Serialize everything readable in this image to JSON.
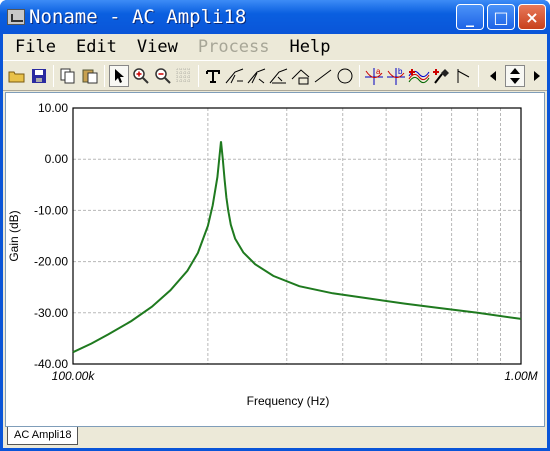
{
  "window": {
    "title": "Noname - AC Ampli18",
    "controls": [
      "_",
      "□",
      "×"
    ]
  },
  "menu": {
    "items": [
      {
        "label": "File",
        "enabled": true
      },
      {
        "label": "Edit",
        "enabled": true
      },
      {
        "label": "View",
        "enabled": true
      },
      {
        "label": "Process",
        "enabled": false
      },
      {
        "label": "Help",
        "enabled": true
      }
    ]
  },
  "toolbar": {
    "tools": [
      "open-icon",
      "save-icon",
      "copy-icon",
      "paste-icon",
      "pointer-icon",
      "zoom-in-icon",
      "zoom-out-icon",
      "grid-icon",
      "text-icon",
      "curve-tool-1-icon",
      "curve-tool-2-icon",
      "curve-tool-3-icon",
      "curve-tool-4-icon",
      "line-icon",
      "circle-icon",
      "cursor-a-icon",
      "cursor-b-icon",
      "add-curve-icon",
      "marker-icon",
      "angle-icon",
      "scroll-left-icon",
      "scroll-updown-icon",
      "scroll-right-icon"
    ]
  },
  "colors": {
    "curve": "#1f7a1f",
    "grid": "#b8b8b8"
  },
  "chart_data": {
    "type": "line",
    "xscale": "log",
    "xlabel": "Frequency (Hz)",
    "ylabel": "Gain (dB)",
    "xlim": [
      100000,
      1000000
    ],
    "ylim": [
      -40,
      10
    ],
    "x_tick_labels": [
      "100.00k",
      "1.00M"
    ],
    "y_ticks": [
      10,
      0,
      -10,
      -20,
      -30,
      -40
    ],
    "y_tick_labels": [
      "10.00",
      "0.00",
      "-10.00",
      "-20.00",
      "-30.00",
      "-40.00"
    ],
    "grid": true,
    "series": [
      {
        "x": [
          100000,
          110000,
          120000,
          135000,
          150000,
          165000,
          180000,
          190000,
          200000,
          205000,
          210000,
          212000,
          214000,
          216000,
          218000,
          220000,
          222000,
          225000,
          230000,
          240000,
          255000,
          280000,
          320000,
          380000,
          450000,
          550000,
          650000,
          800000,
          1000000
        ],
        "y": [
          -37.7,
          -36,
          -34.2,
          -31.6,
          -28.8,
          -25.6,
          -21.8,
          -18.3,
          -13,
          -9,
          -3.5,
          0,
          3.5,
          0,
          -4,
          -7.5,
          -10,
          -12.8,
          -15.5,
          -18.2,
          -20.5,
          -22.8,
          -24.8,
          -26.2,
          -27.1,
          -28.2,
          -29,
          -30,
          -31.2
        ]
      }
    ]
  },
  "status": {
    "tab_label": "AC Ampli18"
  }
}
